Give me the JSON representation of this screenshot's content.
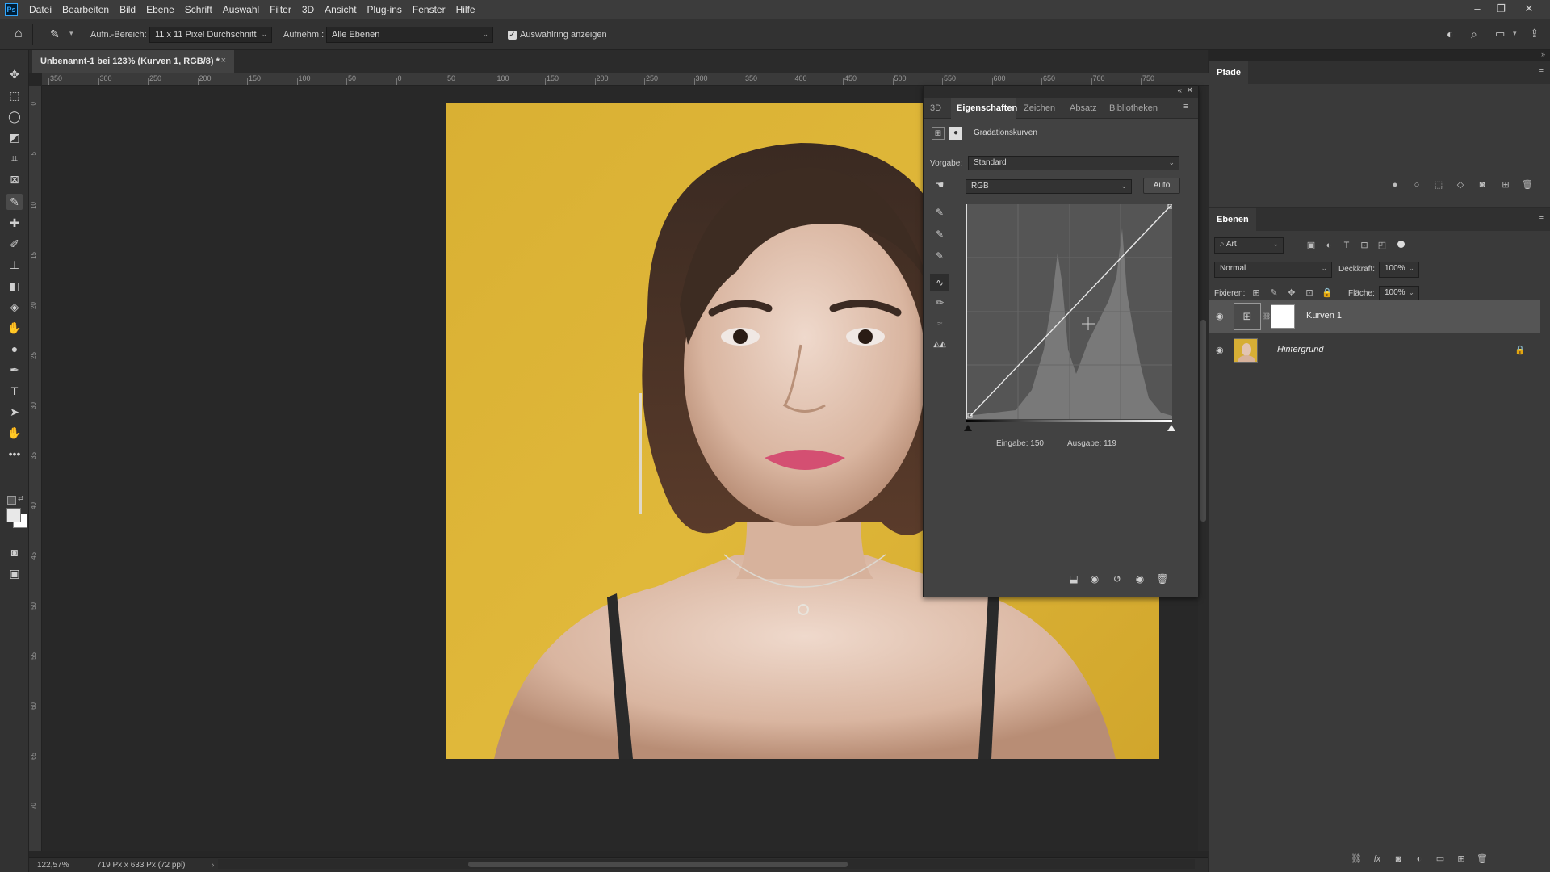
{
  "app": {
    "logo": "Ps"
  },
  "menu": [
    "Datei",
    "Bearbeiten",
    "Bild",
    "Ebene",
    "Schrift",
    "Auswahl",
    "Filter",
    "3D",
    "Ansicht",
    "Plug-ins",
    "Fenster",
    "Hilfe"
  ],
  "options": {
    "sample_size_label": "Aufn.-Bereich:",
    "sample_size_value": "11 x 11 Pixel Durchschnitt",
    "sample_label": "Aufnehm.:",
    "sample_value": "Alle Ebenen",
    "show_ring_label": "Auswahlring anzeigen",
    "show_ring_checked": true
  },
  "document": {
    "tab_title": "Unbenannt-1 bei 123% (Kurven 1, RGB/8) *",
    "close": "×"
  },
  "ruler_top": [
    "350",
    "300",
    "250",
    "200",
    "150",
    "100",
    "50",
    "0",
    "50",
    "100",
    "150",
    "200",
    "250",
    "300",
    "350",
    "400",
    "450",
    "500",
    "550",
    "600",
    "650",
    "700",
    "750"
  ],
  "ruler_left": [
    "0",
    "5",
    "10",
    "15",
    "20",
    "25",
    "30",
    "35",
    "40",
    "45",
    "50",
    "55",
    "60",
    "65",
    "70"
  ],
  "status": {
    "zoom": "122,57%",
    "size": "719 Px x 633 Px (72 ppi)"
  },
  "properties": {
    "tabs": [
      "3D",
      "Eigenschaften",
      "Zeichen",
      "Absatz",
      "Bibliotheken"
    ],
    "active_tab": "Eigenschaften",
    "adjustment_title": "Gradationskurven",
    "preset_label": "Vorgabe:",
    "preset_value": "Standard",
    "channel_value": "RGB",
    "auto_label": "Auto",
    "input_label": "Eingabe: 150",
    "output_label": "Ausgabe: 119"
  },
  "paths_panel": {
    "title": "Pfade"
  },
  "layers_panel": {
    "title": "Ebenen",
    "filter_value": "Art",
    "blend_mode": "Normal",
    "opacity_label": "Deckkraft:",
    "opacity_value": "100%",
    "lock_label": "Fixieren:",
    "fill_label": "Fläche:",
    "fill_value": "100%",
    "layers": [
      {
        "name": "Kurven 1",
        "selected": true
      },
      {
        "name": "Hintergrund",
        "selected": false
      }
    ]
  },
  "colors": {
    "accent_photo_bg": "#dbb337",
    "panel": "#424242"
  }
}
